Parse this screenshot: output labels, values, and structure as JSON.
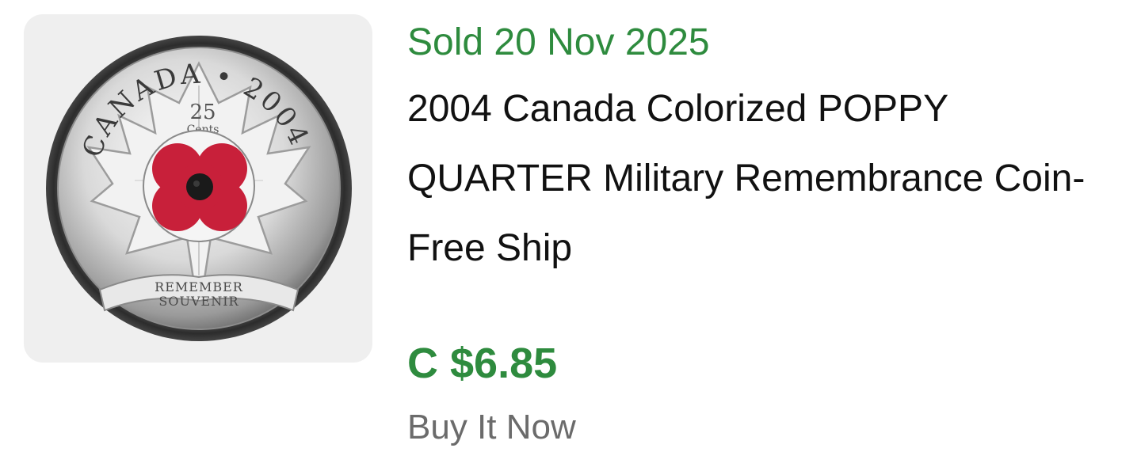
{
  "listing": {
    "status_text": "Sold 20 Nov 2025",
    "title": "2004 Canada Colorized POPPY QUARTER Military Remembrance Coin-Free Ship",
    "price": "C $6.85",
    "format": "Buy It Now",
    "coin_image": {
      "country": "CANADA",
      "year": "2004",
      "denomination_value": "25",
      "denomination_unit": "Cents",
      "banner_line1": "REMEMBER",
      "banner_line2": "SOUVENIR"
    }
  },
  "colors": {
    "status_green": "#2e8b3e",
    "price_green": "#2e8b3e",
    "muted_gray": "#6b6b6b",
    "thumb_bg": "#efefef",
    "poppy_red": "#c8203a"
  }
}
